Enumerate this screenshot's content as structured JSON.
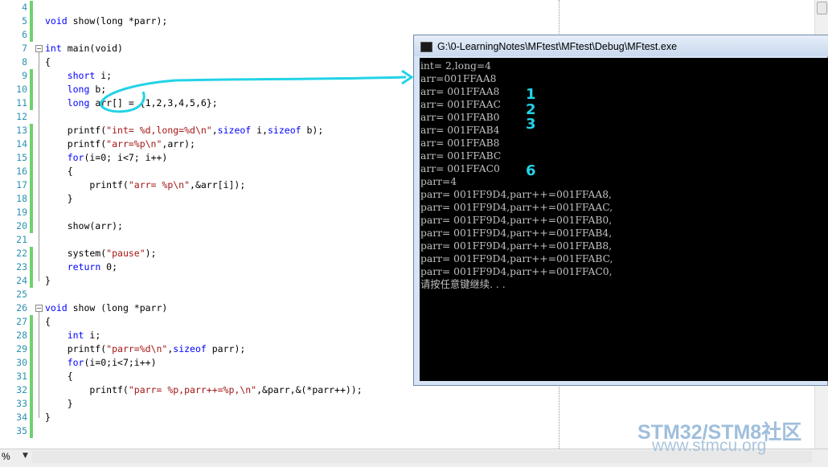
{
  "editor": {
    "lines": [
      {
        "num": "4",
        "segments": []
      },
      {
        "num": "5",
        "segments": [
          {
            "t": "void",
            "c": "kw"
          },
          {
            "t": " show(long *parr);"
          }
        ]
      },
      {
        "num": "6",
        "segments": []
      },
      {
        "num": "7",
        "segments": [
          {
            "t": "int",
            "c": "kw"
          },
          {
            "t": " main(void)"
          }
        ]
      },
      {
        "num": "8",
        "segments": [
          {
            "t": "{"
          }
        ]
      },
      {
        "num": "9",
        "segments": [
          {
            "t": "    "
          },
          {
            "t": "short",
            "c": "kw"
          },
          {
            "t": " i;"
          }
        ]
      },
      {
        "num": "10",
        "segments": [
          {
            "t": "    "
          },
          {
            "t": "long",
            "c": "kw"
          },
          {
            "t": " b;"
          }
        ]
      },
      {
        "num": "11",
        "segments": [
          {
            "t": "    "
          },
          {
            "t": "long",
            "c": "kw"
          },
          {
            "t": " arr[] = {1,2,3,4,5,6};"
          }
        ]
      },
      {
        "num": "12",
        "segments": []
      },
      {
        "num": "13",
        "segments": [
          {
            "t": "    printf("
          },
          {
            "t": "\"int= %d,long=%d\\n\"",
            "c": "str"
          },
          {
            "t": ","
          },
          {
            "t": "sizeof",
            "c": "kw"
          },
          {
            "t": " i,"
          },
          {
            "t": "sizeof",
            "c": "kw"
          },
          {
            "t": " b);"
          }
        ]
      },
      {
        "num": "14",
        "segments": [
          {
            "t": "    printf("
          },
          {
            "t": "\"arr=%p\\n\"",
            "c": "str"
          },
          {
            "t": ",arr);"
          }
        ]
      },
      {
        "num": "15",
        "segments": [
          {
            "t": "    "
          },
          {
            "t": "for",
            "c": "kw"
          },
          {
            "t": "(i=0; i<7; i++)"
          }
        ]
      },
      {
        "num": "16",
        "segments": [
          {
            "t": "    {"
          }
        ]
      },
      {
        "num": "17",
        "segments": [
          {
            "t": "        printf("
          },
          {
            "t": "\"arr= %p\\n\"",
            "c": "str"
          },
          {
            "t": ",&arr[i]);"
          }
        ]
      },
      {
        "num": "18",
        "segments": [
          {
            "t": "    }"
          }
        ]
      },
      {
        "num": "19",
        "segments": []
      },
      {
        "num": "20",
        "segments": [
          {
            "t": "    show(arr);"
          }
        ]
      },
      {
        "num": "21",
        "segments": []
      },
      {
        "num": "22",
        "segments": [
          {
            "t": "    system("
          },
          {
            "t": "\"pause\"",
            "c": "str"
          },
          {
            "t": ");"
          }
        ]
      },
      {
        "num": "23",
        "segments": [
          {
            "t": "    "
          },
          {
            "t": "return",
            "c": "kw"
          },
          {
            "t": " 0;"
          }
        ]
      },
      {
        "num": "24",
        "segments": [
          {
            "t": "}"
          }
        ]
      },
      {
        "num": "25",
        "segments": []
      },
      {
        "num": "26",
        "segments": [
          {
            "t": "void",
            "c": "kw"
          },
          {
            "t": " show (long *parr)"
          }
        ]
      },
      {
        "num": "27",
        "segments": [
          {
            "t": "{"
          }
        ]
      },
      {
        "num": "28",
        "segments": [
          {
            "t": "    "
          },
          {
            "t": "int",
            "c": "kw"
          },
          {
            "t": " i;"
          }
        ]
      },
      {
        "num": "29",
        "segments": [
          {
            "t": "    printf("
          },
          {
            "t": "\"parr=%d\\n\"",
            "c": "str"
          },
          {
            "t": ","
          },
          {
            "t": "sizeof",
            "c": "kw"
          },
          {
            "t": " parr);"
          }
        ]
      },
      {
        "num": "30",
        "segments": [
          {
            "t": "    "
          },
          {
            "t": "for",
            "c": "kw"
          },
          {
            "t": "(i=0;i<7;i++)"
          }
        ]
      },
      {
        "num": "31",
        "segments": [
          {
            "t": "    {"
          }
        ]
      },
      {
        "num": "32",
        "segments": [
          {
            "t": "        printf("
          },
          {
            "t": "\"parr= %p,parr++=%p,\\n\"",
            "c": "str"
          },
          {
            "t": ",&parr,&(*parr++));"
          }
        ]
      },
      {
        "num": "33",
        "segments": [
          {
            "t": "    }"
          }
        ]
      },
      {
        "num": "34",
        "segments": [
          {
            "t": "}"
          }
        ]
      },
      {
        "num": "35",
        "segments": []
      }
    ]
  },
  "statusbar": {
    "zoom": "%"
  },
  "console": {
    "title": "G:\\0-LearningNotes\\MFtest\\MFtest\\Debug\\MFtest.exe",
    "lines": [
      "int= 2,long=4",
      "arr=001FFAA8",
      "arr= 001FFAA8",
      "arr= 001FFAAC",
      "arr= 001FFAB0",
      "arr= 001FFAB4",
      "arr= 001FFAB8",
      "arr= 001FFABC",
      "arr= 001FFAC0",
      "parr=4",
      "parr= 001FF9D4,parr++=001FFAA8,",
      "parr= 001FF9D4,parr++=001FFAAC,",
      "parr= 001FF9D4,parr++=001FFAB0,",
      "parr= 001FF9D4,parr++=001FFAB4,",
      "parr= 001FF9D4,parr++=001FFAB8,",
      "parr= 001FF9D4,parr++=001FFABC,",
      "parr= 001FF9D4,parr++=001FFAC0,",
      "请按任意键继续. . ."
    ]
  },
  "annotations": {
    "marks": [
      "1",
      "2",
      "3",
      "6"
    ]
  },
  "watermark": {
    "brand": "STM32/STM8社区",
    "url": "www.stmcu.org"
  },
  "colors": {
    "keyword": "#0000ff",
    "string": "#a31515",
    "line_number": "#2b91af",
    "change_bar": "#6fd06f",
    "annotation": "#22d3e6"
  }
}
